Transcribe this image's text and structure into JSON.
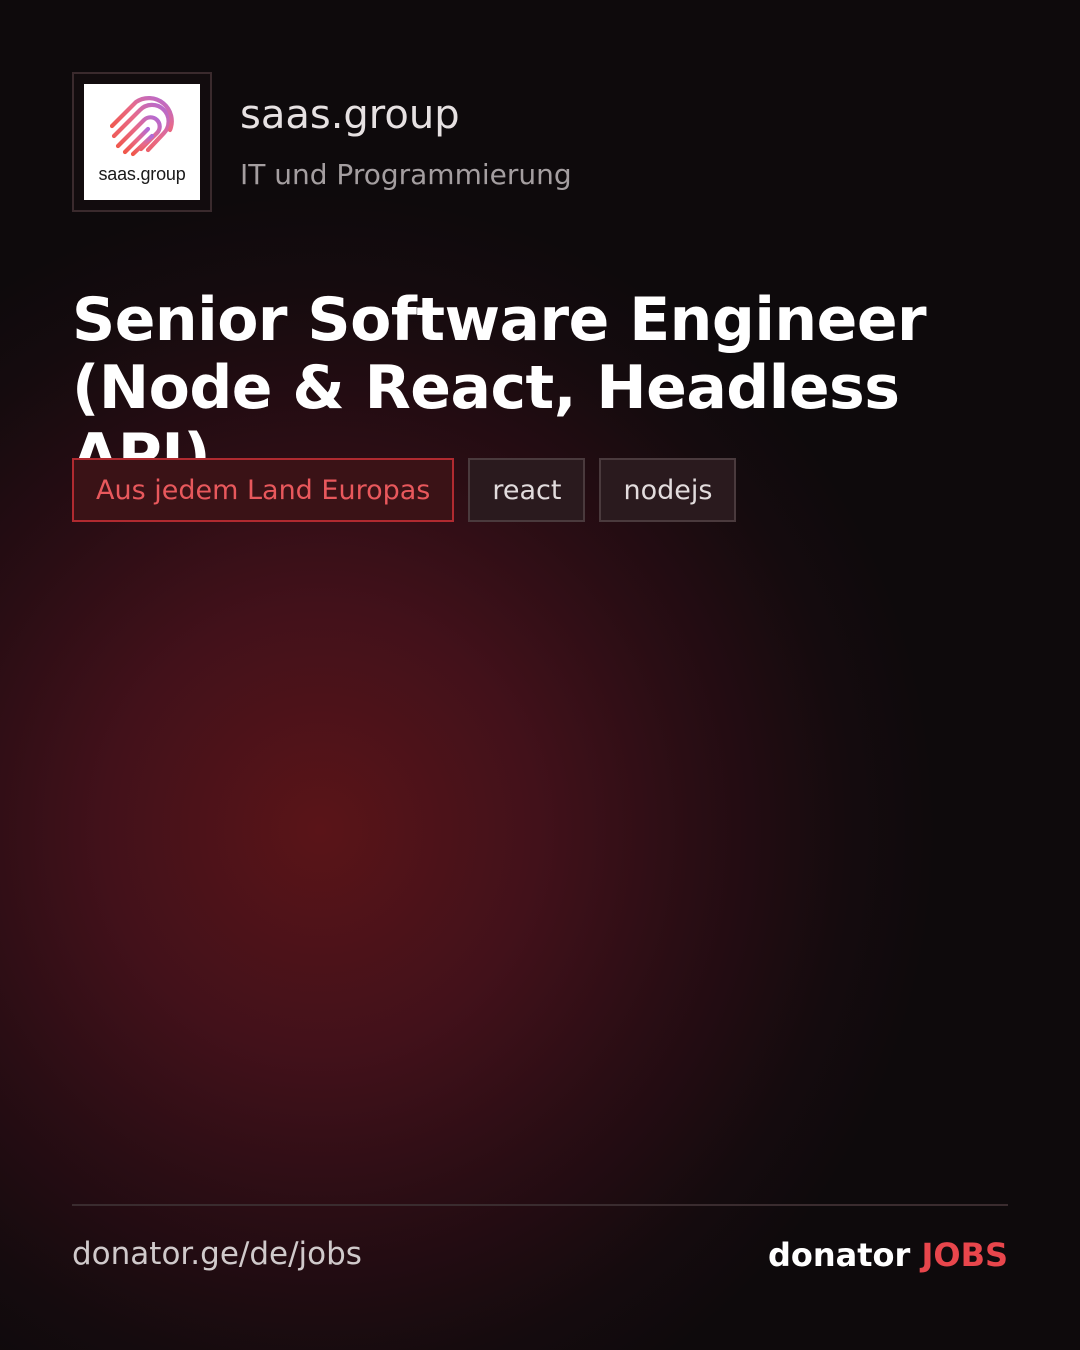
{
  "company": {
    "logo_text": "saas.group",
    "name": "saas.group",
    "category": "IT und Programmierung"
  },
  "job": {
    "title_line1": "Senior Software Engineer",
    "title_line2": "(Node & React, Headless API)"
  },
  "tags": [
    {
      "label": "Aus jedem Land Europas",
      "kind": "location"
    },
    {
      "label": "react",
      "kind": "skill"
    },
    {
      "label": "nodejs",
      "kind": "skill"
    }
  ],
  "footer": {
    "url": "donator.ge/de/jobs",
    "brand_name": "donator",
    "brand_suffix": "JOBS"
  },
  "colors": {
    "accent": "#e8464c",
    "background_glow": "#5a1418",
    "background_dark": "#0e0a0c"
  },
  "icons": {
    "logo": "fingerprint-logo-icon"
  }
}
